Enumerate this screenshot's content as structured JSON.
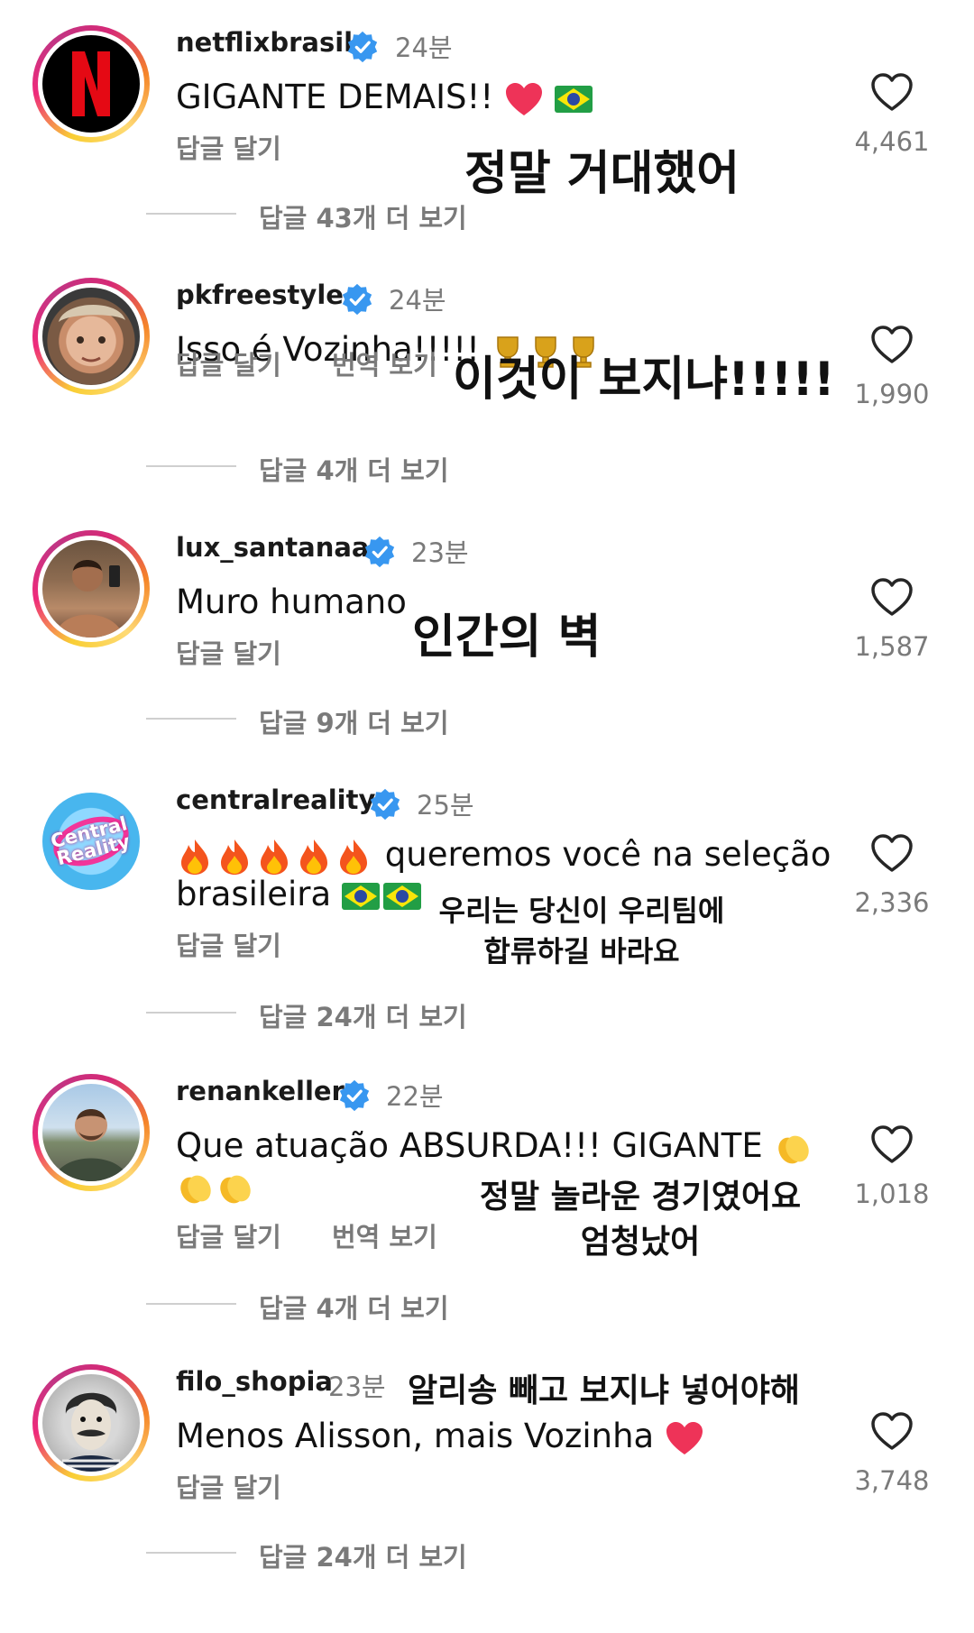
{
  "comments": [
    {
      "username": "netflixbrasil",
      "time": "24분",
      "text": "GIGANTE DEMAIS!!",
      "actions": [
        "답글 달기"
      ],
      "likes": "4,461",
      "replies": "답글 43개 더 보기",
      "overlay": [
        "정말 거대했어"
      ],
      "avatar": "netflix-logo"
    },
    {
      "username": "pkfreestyle",
      "time": "24분",
      "text": "Isso é Vozinha!!!!!",
      "actions": [
        "답글 달기",
        "번역 보기"
      ],
      "likes": "1,990",
      "replies": "답글 4개 더 보기",
      "overlay": [
        "이것이 보지냐!!!!!"
      ],
      "avatar": "person-photo"
    },
    {
      "username": "lux_santanaa",
      "time": "23분",
      "text": "Muro humano",
      "actions": [
        "답글 달기"
      ],
      "likes": "1,587",
      "replies": "답글 9개 더 보기",
      "overlay": [
        "인간의 벽"
      ],
      "avatar": "person-photo"
    },
    {
      "username": "centralreality",
      "time": "25분",
      "text_lines": [
        "queremos você na seleção",
        "brasileira"
      ],
      "actions": [
        "답글 달기"
      ],
      "likes": "2,336",
      "replies": "답글 24개 더 보기",
      "overlay": [
        "우리는 당신이 우리팀에",
        "합류하길 바라요"
      ],
      "avatar_text": [
        "Central",
        "Reality"
      ]
    },
    {
      "username": "renankeller",
      "time": "22분",
      "text": "Que atuação ABSURDA!!! GIGANTE",
      "actions": [
        "답글 달기",
        "번역 보기"
      ],
      "likes": "1,018",
      "replies": "답글 4개 더 보기",
      "overlay": [
        "정말 놀라운 경기였어요",
        "엄청났어"
      ],
      "avatar": "person-photo"
    },
    {
      "username": "filo_shopia",
      "time": "23분",
      "text": "Menos Alisson, mais Vozinha",
      "actions": [
        "답글 달기"
      ],
      "likes": "3,748",
      "replies": "답글 24개 더 보기",
      "overlay": [
        "알리송 빼고 보지냐 넣어야해"
      ],
      "avatar": "illustration-portrait"
    }
  ],
  "colors": {
    "verified": "#3897f0",
    "muted": "#7a7a7a",
    "heart_emoji": "#ee3358",
    "netflix_red": "#e50914"
  }
}
